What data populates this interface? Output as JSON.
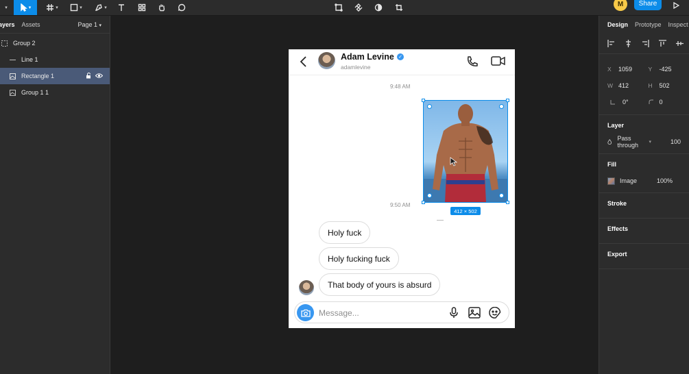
{
  "toolbar": {
    "user_initial": "M",
    "share_label": "Share"
  },
  "left_panel": {
    "tabs": [
      "ayers",
      "Assets"
    ],
    "page_selector": "Page 1",
    "layers": [
      {
        "name": "Group 2"
      },
      {
        "name": "Line 1"
      },
      {
        "name": "Rectangle 1"
      },
      {
        "name": "Group 1 1"
      }
    ]
  },
  "right_panel": {
    "tabs": [
      "Design",
      "Prototype",
      "Inspect"
    ],
    "x": "1059",
    "y": "-425",
    "w": "412",
    "h": "502",
    "rotation": "0°",
    "radius": "0",
    "labels": {
      "x": "X",
      "y": "Y",
      "w": "W",
      "h": "H"
    },
    "layer_title": "Layer",
    "blend_mode": "Pass through",
    "opacity": "100",
    "fill_title": "Fill",
    "fill_type": "Image",
    "fill_opacity": "100%",
    "stroke_title": "Stroke",
    "effects_title": "Effects",
    "export_title": "Export"
  },
  "phone": {
    "name": "Adam Levine",
    "username": "adamlevine",
    "timestamp_1": "9:48 AM",
    "timestamp_2": "9:50 AM",
    "image_size_label": "412 × 502",
    "messages": [
      "Holy fuck",
      "Holy fucking fuck",
      "That body of yours is absurd"
    ],
    "composer_placeholder": "Message..."
  },
  "colors": {
    "accent": "#0c8ce9",
    "ig_blue": "#3897f0",
    "panel_bg": "#2c2c2c",
    "canvas_bg": "#1e1e1e",
    "selected_layer": "#4a5a78"
  }
}
